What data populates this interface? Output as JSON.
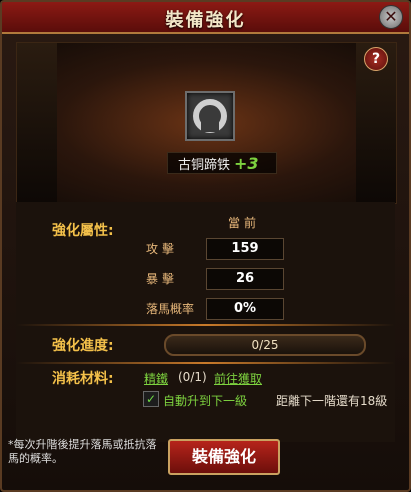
{
  "window": {
    "title": "裝備強化"
  },
  "item": {
    "name": "古铜蹄铁",
    "level": "+3"
  },
  "section_attributes": {
    "label": "強化屬性:",
    "current_label": "當前"
  },
  "attributes": [
    {
      "name": "攻擊",
      "value": "159"
    },
    {
      "name": "暴擊",
      "value": "26"
    },
    {
      "name": "落馬概率",
      "value": "0%"
    }
  ],
  "progress": {
    "label": "強化進度:",
    "text": "0/25",
    "fraction": 0
  },
  "materials": {
    "label": "消耗材料:",
    "item": "精鐵",
    "count": "(0/1)",
    "get_link": "前往獲取"
  },
  "auto": {
    "label": "自動升到下一級",
    "next_text": "距離下一階還有18級"
  },
  "footer": {
    "note": "*每次升階後提升落馬或抵抗落馬的概率。",
    "button": "裝備強化"
  }
}
